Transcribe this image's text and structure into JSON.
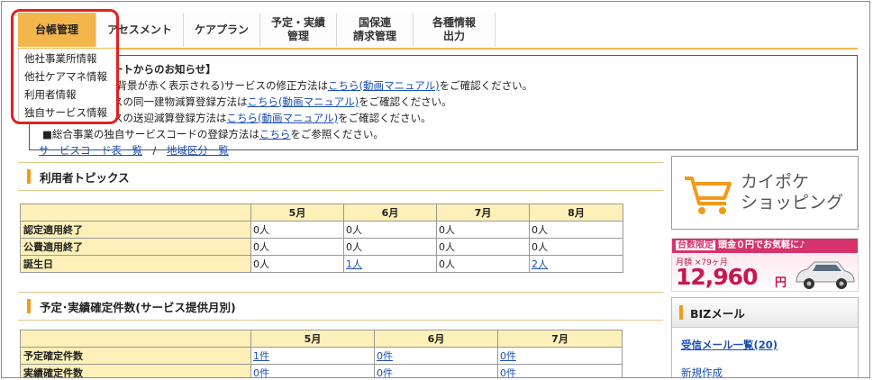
{
  "nav": {
    "items": [
      {
        "label": "台帳管理",
        "label2": ""
      },
      {
        "label": "アセスメント",
        "label2": ""
      },
      {
        "label": "ケアプラン",
        "label2": ""
      },
      {
        "label": "予定・実績",
        "label2": "管理"
      },
      {
        "label": "国保連",
        "label2": "請求管理"
      },
      {
        "label": "各種情報",
        "label2": "出力"
      }
    ]
  },
  "dropdown": {
    "items": [
      "他社事業所情報",
      "他社ケアマネ情報",
      "利用者情報",
      "独自サービス情報"
    ]
  },
  "notice": {
    "title": "ートからのお知らせ】",
    "line1_pre": "(背景が赤く表示される)サービスの修正方法は",
    "line1_link": "こちら(動画マニュアル)",
    "line1_post": "をご確認ください。",
    "line2_pre": "スの同一建物減算登録方法は",
    "line2_link": "こちら(動画マニュアル)",
    "line2_post": "をご確認ください。",
    "line3_pre": "スの送迎減算登録方法は",
    "line3_link": "こちら(動画マニュアル)",
    "line3_post": "をご確認ください。",
    "line4_pre": "■総合事業の独自サービスコードの登録方法は",
    "line4_link": "こちら",
    "line4_post": "をご参照ください。",
    "link_a": "サービスコード表一覧",
    "sep": "/",
    "link_b": "地域区分一覧"
  },
  "topics": {
    "title": "利用者トピックス",
    "months": [
      "5月",
      "6月",
      "7月",
      "8月"
    ],
    "rows": [
      {
        "label": "認定適用終了",
        "cells": [
          "0人",
          "0人",
          "0人",
          "0人"
        ]
      },
      {
        "label": "公費適用終了",
        "cells": [
          "0人",
          "0人",
          "0人",
          "0人"
        ]
      },
      {
        "label": "誕生日",
        "cells": [
          "0人",
          "1人",
          "0人",
          "2人"
        ]
      }
    ]
  },
  "confirm": {
    "title": "予定･実績確定件数(サービス提供月別)",
    "months": [
      "5月",
      "6月",
      "7月"
    ],
    "rows": [
      {
        "label": "予定確定件数",
        "cells": [
          "1件",
          "0件",
          "0件"
        ]
      },
      {
        "label": "実績確定件数",
        "cells": [
          "0件",
          "0件",
          "0件"
        ]
      }
    ]
  },
  "shop": {
    "line1": "カイポケ",
    "line2": "ショッピング"
  },
  "ad": {
    "tag": "台数限定",
    "headline": "頭金０円でお気軽に♪",
    "price_lead": "月額 ×79ヶ月",
    "price": "12,960",
    "yen": "円"
  },
  "biz": {
    "title": "BIZメール",
    "inbox": "受信メール一覧(20)",
    "compose": "新規作成"
  },
  "colors": {
    "accent": "#f3b64c",
    "link": "#1a4fb5",
    "highlight": "#e02020",
    "table_header": "#fdf0b8"
  }
}
